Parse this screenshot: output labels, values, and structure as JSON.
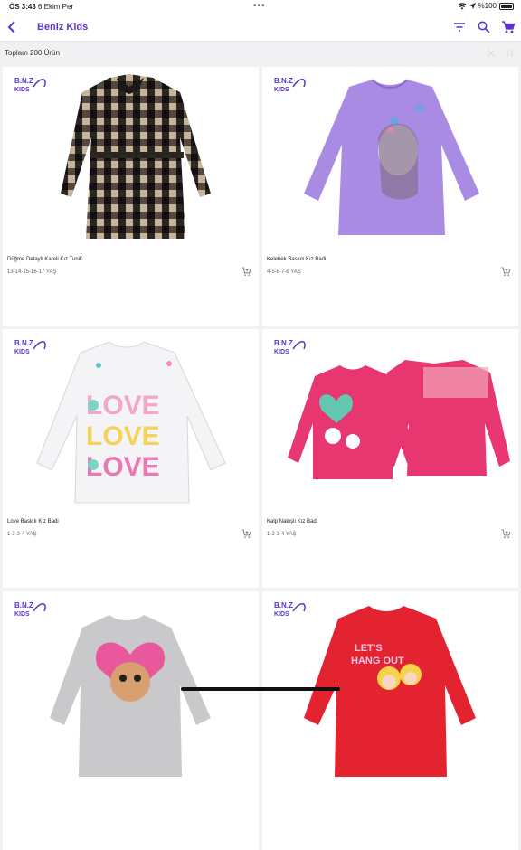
{
  "status": {
    "time": "ÖS 3:43",
    "date": "6 Ekim Per",
    "battery": "%100"
  },
  "header": {
    "title": "Beniz Kids"
  },
  "summary": {
    "total_text": "Toplam 200 Ürün"
  },
  "brand_logo": {
    "line1": "B.N.Z",
    "line2": "KIDS",
    "color": "#5a35c8"
  },
  "products": [
    {
      "name": "Düğme Detaylı Kareli Kız Tunik",
      "sizes": "13-14-15-16-17 YAŞ",
      "image": "plaid-tunic"
    },
    {
      "name": "Kelebek Baskılı Kız Badi",
      "sizes": "4-5-6-7-8 YAŞ",
      "image": "lilac-butterfly-top"
    },
    {
      "name": "Love Baskılı Kız Badi",
      "sizes": "1-2-3-4 YAŞ",
      "image": "white-love-top"
    },
    {
      "name": "Kalp Nakışlı Kız Badi",
      "sizes": "1-2-3-4 YAŞ",
      "image": "pink-heart-top"
    },
    {
      "name": "",
      "sizes": "",
      "image": "grey-fawn-top"
    },
    {
      "name": "",
      "sizes": "",
      "image": "red-hangout-top"
    }
  ],
  "colors": {
    "accent": "#5a35c8",
    "background": "#f1f1f3"
  }
}
